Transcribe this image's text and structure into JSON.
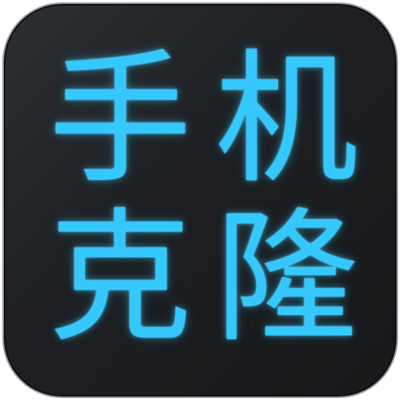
{
  "app_icon": {
    "characters": [
      "手",
      "机",
      "克",
      "隆"
    ],
    "glyph_color": "#34c8ff",
    "background_color": "#1d1f22",
    "border_color": "#9a9ea3"
  }
}
